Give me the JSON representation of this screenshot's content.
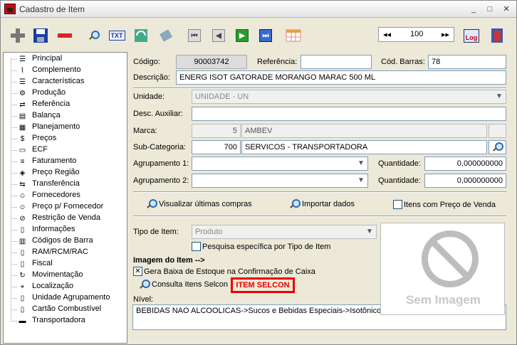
{
  "window": {
    "title": "Cadastro de Item",
    "minimize": "_",
    "maximize": "□",
    "close": "✕"
  },
  "toolbar": {
    "txt_label": "TXT",
    "pager_first": "◂◂",
    "pager_value": "100",
    "pager_last": "▸▸",
    "log_label": "Log"
  },
  "tree": {
    "items": [
      {
        "label": "Principal",
        "icon": "list-icon"
      },
      {
        "label": "Complemento",
        "icon": "clip-icon"
      },
      {
        "label": "Características",
        "icon": "list-icon"
      },
      {
        "label": "Produção",
        "icon": "factory-icon"
      },
      {
        "label": "Referência",
        "icon": "reference-icon"
      },
      {
        "label": "Balança",
        "icon": "scale-icon"
      },
      {
        "label": "Planejamento",
        "icon": "calendar-icon"
      },
      {
        "label": "Preços",
        "icon": "price-icon"
      },
      {
        "label": "ECF",
        "icon": "printer-icon"
      },
      {
        "label": "Faturamento",
        "icon": "invoice-icon"
      },
      {
        "label": "Preço Região",
        "icon": "region-icon"
      },
      {
        "label": "Transferência",
        "icon": "transfer-icon"
      },
      {
        "label": "Fornecedores",
        "icon": "people-icon"
      },
      {
        "label": "Preço p/ Fornecedor",
        "icon": "people-icon"
      },
      {
        "label": "Restrição de Venda",
        "icon": "restriction-icon"
      },
      {
        "label": "Informações",
        "icon": "doc-icon"
      },
      {
        "label": "Códigos de Barra",
        "icon": "barcode-icon"
      },
      {
        "label": "RAM/RCM/RAC",
        "icon": "doc-icon"
      },
      {
        "label": "Fiscal",
        "icon": "doc-icon"
      },
      {
        "label": "Movimentação",
        "icon": "movement-icon"
      },
      {
        "label": "Localização",
        "icon": "location-icon"
      },
      {
        "label": "Unidade Agrupamento",
        "icon": "doc-icon"
      },
      {
        "label": "Cartão Combustível",
        "icon": "doc-icon"
      },
      {
        "label": "Transportadora",
        "icon": "truck-icon"
      }
    ]
  },
  "form": {
    "codigo_label": "Código:",
    "codigo_value": "90003742",
    "referencia_label": "Referência:",
    "referencia_value": "",
    "cod_barras_label": "Cód. Barras:",
    "cod_barras_value": "78",
    "descricao_label": "Descrição:",
    "descricao_value": "ENERG ISOT GATORADE MORANGO MARAC 500 ML",
    "unidade_label": "Unidade:",
    "unidade_value": "UNIDADE - UN",
    "desc_aux_label": "Desc. Auxiliar:",
    "desc_aux_value": "",
    "marca_label": "Marca:",
    "marca_code": "5",
    "marca_name": "AMBEV",
    "subcat_label": "Sub-Categoria:",
    "subcat_code": "700",
    "subcat_name": "SERVICOS - TRANSPORTADORA",
    "agrup1_label": "Agrupamento 1:",
    "agrup2_label": "Agrupamento 2:",
    "qtd_label": "Quantidade:",
    "qtd1_value": "0,000000000",
    "qtd2_value": "0,000000000",
    "visualizar_compras": "Visualizar últimas compras",
    "importar_dados": "Importar dados",
    "itens_preco_venda": "Itens com Preço de Venda",
    "tipo_item_label": "Tipo de Item:",
    "tipo_item_value": "Produto",
    "pesquisa_especifica": "Pesquisa específica por Tipo de Item",
    "imagem_label": "Imagem do Item -->",
    "gera_baixa": "Gera Baixa de Estoque na Confirmação de Caixa",
    "consulta_selcon": "Consulta Itens Selcon",
    "item_selcon": "ITEM SELCON",
    "nivel_label": "Nível:",
    "nivel_value": "BEBIDAS NAO ALCOOLICAS->Sucos e Bebidas Especiais->Isotônico ->Isotônico",
    "sem_imagem": "Sem Imagem"
  },
  "colors": {
    "selcon_red": "#e00000",
    "window_bg": "#ece9d8"
  }
}
